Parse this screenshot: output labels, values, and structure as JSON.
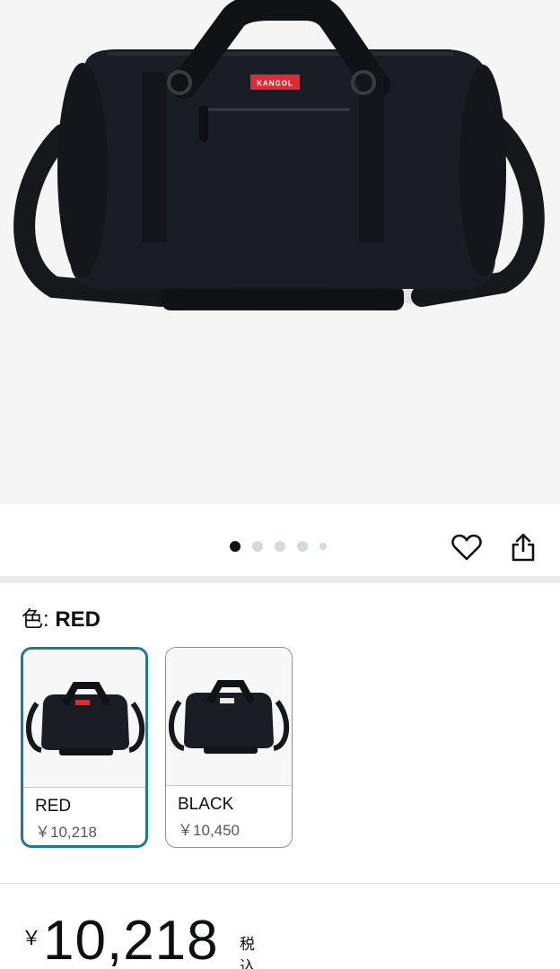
{
  "product_image": {
    "brand_label": "KANGOL"
  },
  "carousel": {
    "dots": 5,
    "active_index": 0
  },
  "actions": {
    "wishlist_icon": "heart-icon",
    "share_icon": "share-icon"
  },
  "color_selector": {
    "label": "色: ",
    "selected_value": "RED",
    "options": [
      {
        "name": "RED",
        "price": "￥10,218",
        "selected": true
      },
      {
        "name": "BLACK",
        "price": "￥10,450",
        "selected": false
      }
    ]
  },
  "price": {
    "currency_symbol": "￥",
    "amount": "10,218",
    "tax_note": "税込"
  },
  "colors": {
    "selected_border": "#1f7a8c",
    "bag": "#1b1d24",
    "label_red": "#e02b36"
  }
}
